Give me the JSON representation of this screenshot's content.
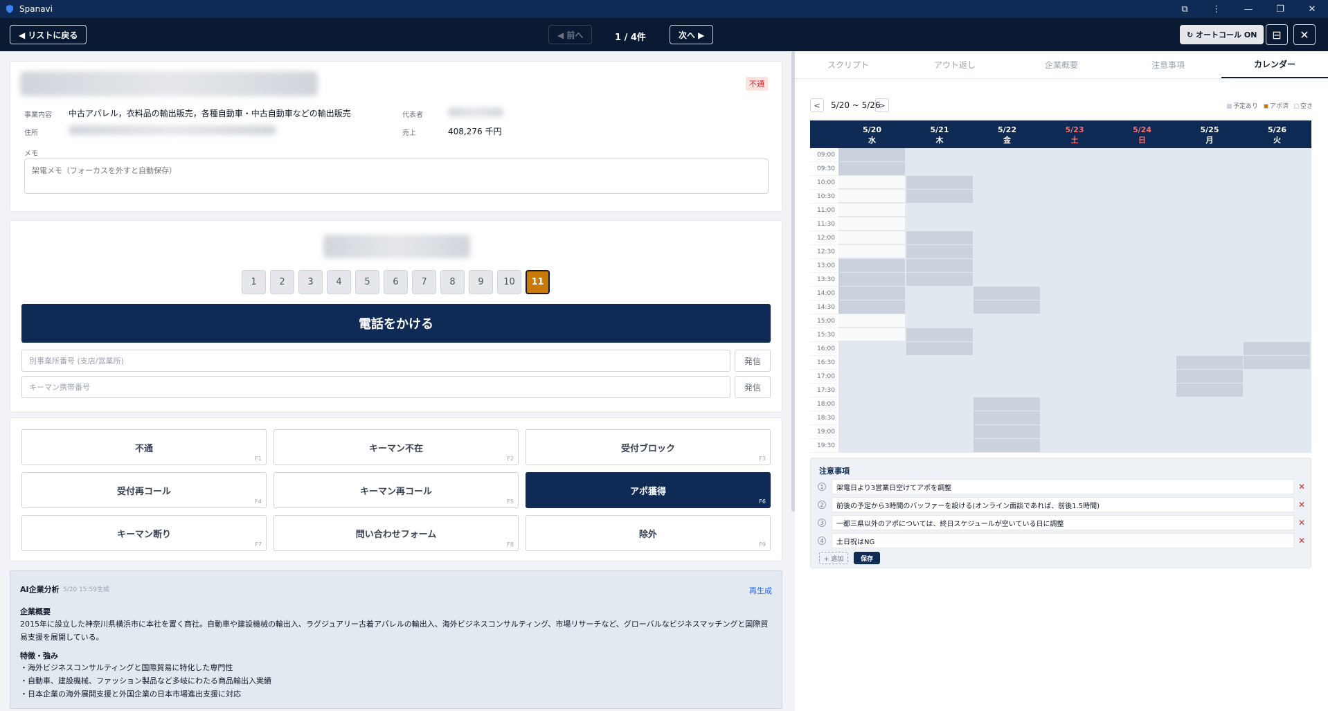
{
  "window": {
    "title": "Spanavi"
  },
  "toolbar": {
    "back_label": "◀ リストに戻る",
    "prev_label": "◀ 前へ",
    "count": "1 / 4件",
    "next_label": "次へ ▶",
    "autocall_label": "↻ オートコール ON"
  },
  "company": {
    "status": "不通",
    "business_label": "事業内容",
    "business_value": "中古アパレル，衣料品の輸出販売，各種自動車・中古自動車などの輸出販売",
    "address_label": "住所",
    "rep_label": "代表者",
    "sales_label": "売上",
    "sales_value": "408,276 千円",
    "memo_label": "メモ",
    "memo_placeholder": "架電メモ（フォーカスを外すと自動保存）"
  },
  "call": {
    "numbers": [
      "1",
      "2",
      "3",
      "4",
      "5",
      "6",
      "7",
      "8",
      "9",
      "10",
      "11"
    ],
    "active_number": "11",
    "call_label": "電話をかける",
    "branch_placeholder": "別事業所番号 (支店/営業所)",
    "keyman_placeholder": "キーマン携帯番号",
    "dial_label": "発信"
  },
  "results": [
    {
      "label": "不通",
      "key": "F1"
    },
    {
      "label": "キーマン不在",
      "key": "F2"
    },
    {
      "label": "受付ブロック",
      "key": "F3"
    },
    {
      "label": "受付再コール",
      "key": "F4"
    },
    {
      "label": "キーマン再コール",
      "key": "F5"
    },
    {
      "label": "アポ獲得",
      "key": "F6"
    },
    {
      "label": "キーマン断り",
      "key": "F7"
    },
    {
      "label": "問い合わせフォーム",
      "key": "F8"
    },
    {
      "label": "除外",
      "key": "F9"
    }
  ],
  "ai": {
    "title": "AI企業分析",
    "generated": "5/20 15:59生成",
    "regenerate": "再生成",
    "overview_heading": "企業概要",
    "overview_text": "2015年に設立した神奈川県横浜市に本社を置く商社。自動車や建設機械の輸出入、ラグジュアリー古着アパレルの輸出入、海外ビジネスコンサルティング、市場リサーチなど、グローバルなビジネスマッチングと国際貿易支援を展開している。",
    "strengths_heading": "特徴・強み",
    "strengths": [
      "・海外ビジネスコンサルティングと国際貿易に特化した専門性",
      "・自動車、建設機械、ファッション製品など多岐にわたる商品輸出入実績",
      "・日本企業の海外展開支援と外国企業の日本市場進出支援に対応"
    ]
  },
  "tabs": [
    "スクリプト",
    "アウト返し",
    "企業概要",
    "注意事項",
    "カレンダー"
  ],
  "active_tab": "カレンダー",
  "calendar": {
    "prev": "<",
    "next": ">",
    "week": "5/20 ~ 5/26",
    "legend": [
      {
        "label": "予定あり",
        "color": "#c9d2dd"
      },
      {
        "label": "アポ済",
        "color": "#c87a08"
      },
      {
        "label": "空き",
        "color": "#f8fafc"
      }
    ],
    "days": [
      {
        "date": "5/20",
        "dow": "水",
        "weekend": false
      },
      {
        "date": "5/21",
        "dow": "木",
        "weekend": false
      },
      {
        "date": "5/22",
        "dow": "金",
        "weekend": false
      },
      {
        "date": "5/23",
        "dow": "土",
        "weekend": true
      },
      {
        "date": "5/24",
        "dow": "日",
        "weekend": true
      },
      {
        "date": "5/25",
        "dow": "月",
        "weekend": false
      },
      {
        "date": "5/26",
        "dow": "火",
        "weekend": false
      }
    ],
    "times": [
      "09:00",
      "09:30",
      "10:00",
      "10:30",
      "11:00",
      "11:30",
      "12:00",
      "12:30",
      "13:00",
      "13:30",
      "14:00",
      "14:30",
      "15:00",
      "15:30",
      "16:00",
      "16:30",
      "17:00",
      "17:30",
      "18:00",
      "18:30",
      "19:00",
      "19:30"
    ],
    "busy": [
      [
        0,
        0
      ],
      [
        0,
        1
      ],
      [
        0,
        8
      ],
      [
        0,
        9
      ],
      [
        0,
        10
      ],
      [
        0,
        11
      ],
      [
        1,
        2
      ],
      [
        1,
        3
      ],
      [
        1,
        6
      ],
      [
        1,
        7
      ],
      [
        1,
        8
      ],
      [
        1,
        9
      ],
      [
        1,
        13
      ],
      [
        1,
        14
      ],
      [
        2,
        10
      ],
      [
        2,
        11
      ],
      [
        2,
        18
      ],
      [
        2,
        19
      ],
      [
        2,
        20
      ],
      [
        2,
        21
      ],
      [
        5,
        15
      ],
      [
        5,
        16
      ],
      [
        5,
        17
      ],
      [
        6,
        14
      ],
      [
        6,
        15
      ]
    ],
    "free": [
      [
        0,
        2
      ],
      [
        0,
        3
      ],
      [
        0,
        4
      ],
      [
        0,
        5
      ],
      [
        0,
        6
      ],
      [
        0,
        7
      ],
      [
        0,
        12
      ],
      [
        0,
        13
      ]
    ]
  },
  "notes": {
    "title": "注意事項",
    "items": [
      "架電日より3営業日空けてアポを調整",
      "前後の予定から3時間のバッファーを設ける(オンライン面談であれば、前後1.5時間)",
      "一都三県以外のアポについては、終日スケジュールが空いている日に調整",
      "土日祝はNG"
    ],
    "add_label": "+ 追加",
    "save_label": "保存"
  }
}
